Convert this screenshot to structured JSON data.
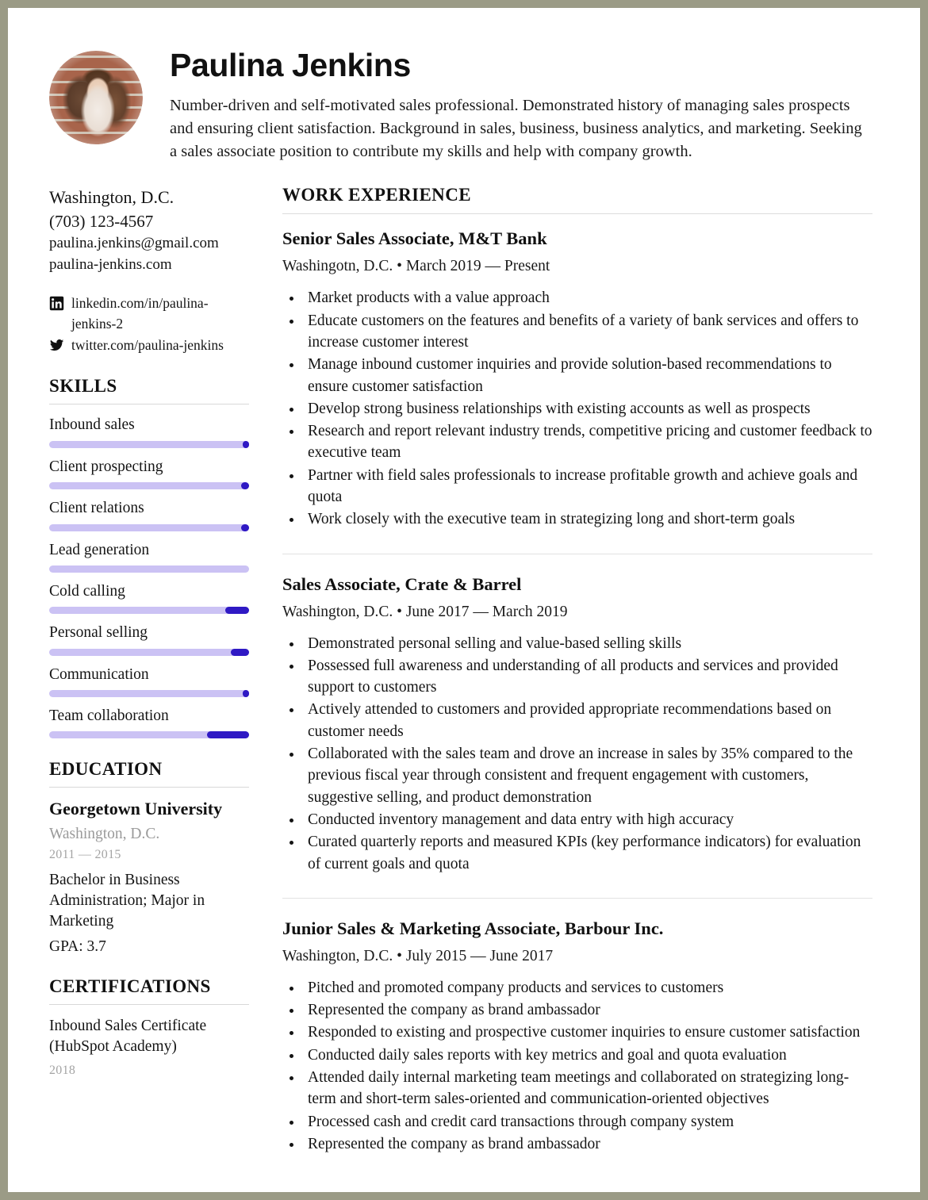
{
  "header": {
    "name": "Paulina Jenkins",
    "avatar_alt": "profile-photo",
    "summary": "Number-driven and self-motivated sales professional. Demonstrated history of managing sales prospects and ensuring client satisfaction. Background in sales, business, business analytics, and marketing. Seeking a sales associate position to contribute my skills and help with company growth."
  },
  "contact": {
    "city": "Washington, D.C.",
    "phone": "(703) 123-4567",
    "email": "paulina.jenkins@gmail.com",
    "website": "paulina-jenkins.com",
    "social": [
      {
        "icon": "linkedin-icon",
        "text": "linkedin.com/in/paulina-jenkins-2"
      },
      {
        "icon": "twitter-icon",
        "text": "twitter.com/paulina-jenkins"
      }
    ]
  },
  "skills": {
    "heading": "SKILLS",
    "items": [
      {
        "label": "Inbound sales",
        "level": 97,
        "knob": 3
      },
      {
        "label": "Client prospecting",
        "level": 96,
        "knob": 4
      },
      {
        "label": "Client relations",
        "level": 96,
        "knob": 4
      },
      {
        "label": "Lead generation",
        "level": 100,
        "knob": 0
      },
      {
        "label": "Cold calling",
        "level": 88,
        "knob": 12
      },
      {
        "label": "Personal selling",
        "level": 91,
        "knob": 9
      },
      {
        "label": "Communication",
        "level": 97,
        "knob": 3
      },
      {
        "label": "Team collaboration",
        "level": 79,
        "knob": 21
      }
    ]
  },
  "education": {
    "heading": "EDUCATION",
    "school": "Georgetown University",
    "place": "Washington, D.C.",
    "years": "2011 — 2015",
    "degree": "Bachelor in Business Administration; Major in Marketing",
    "gpa": "GPA: 3.7"
  },
  "certifications": {
    "heading": "CERTIFICATIONS",
    "name": "Inbound Sales Certificate (HubSpot Academy)",
    "year": "2018"
  },
  "experience": {
    "heading": "WORK EXPERIENCE",
    "jobs": [
      {
        "title": "Senior Sales Associate, M&T Bank",
        "meta": "Washingotn, D.C. • March 2019 — Present",
        "bullets": [
          "Market products with a value approach",
          "Educate customers on the features and benefits of a variety of bank services and offers to increase customer interest",
          "Manage inbound customer inquiries and provide solution-based recommendations to ensure customer satisfaction",
          "Develop strong business relationships with existing accounts as well as prospects",
          "Research and report relevant industry trends, competitive pricing and customer feedback to executive team",
          "Partner with field sales professionals to increase profitable growth and achieve goals and quota",
          "Work closely with the executive team in strategizing long and short-term goals"
        ]
      },
      {
        "title": "Sales Associate, Crate & Barrel",
        "meta": "Washington, D.C. • June 2017 — March 2019",
        "bullets": [
          "Demonstrated personal selling and value-based selling skills",
          "Possessed full awareness and understanding of all products and services and provided support to customers",
          "Actively attended to customers and provided appropriate recommendations based on customer needs",
          "Collaborated with the sales team and drove an increase in sales by 35% compared to the previous fiscal year through consistent and frequent engagement with customers, suggestive selling, and product demonstration",
          "Conducted inventory management and data entry with high accuracy",
          "Curated quarterly reports and measured KPIs (key performance indicators) for evaluation of current goals and quota"
        ]
      },
      {
        "title": "Junior Sales & Marketing Associate, Barbour Inc.",
        "meta": "Washington, D.C. • July 2015 — June 2017",
        "bullets": [
          "Pitched and promoted company products and services to customers",
          "Represented the company as brand ambassador",
          "Responded to existing and prospective customer inquiries to ensure customer satisfaction",
          "Conducted daily sales reports with key metrics and goal and quota evaluation",
          "Attended daily internal marketing team meetings and collaborated on strategizing long-term and short-term sales-oriented and communication-oriented objectives",
          "Processed cash and credit card transactions through company system",
          "Represented the company as brand ambassador"
        ]
      }
    ]
  },
  "colors": {
    "skill_track": "#cbc2f4",
    "skill_knob": "#2f19c4",
    "page_border": "#9b9b86",
    "muted_text": "#9a9a9a"
  }
}
